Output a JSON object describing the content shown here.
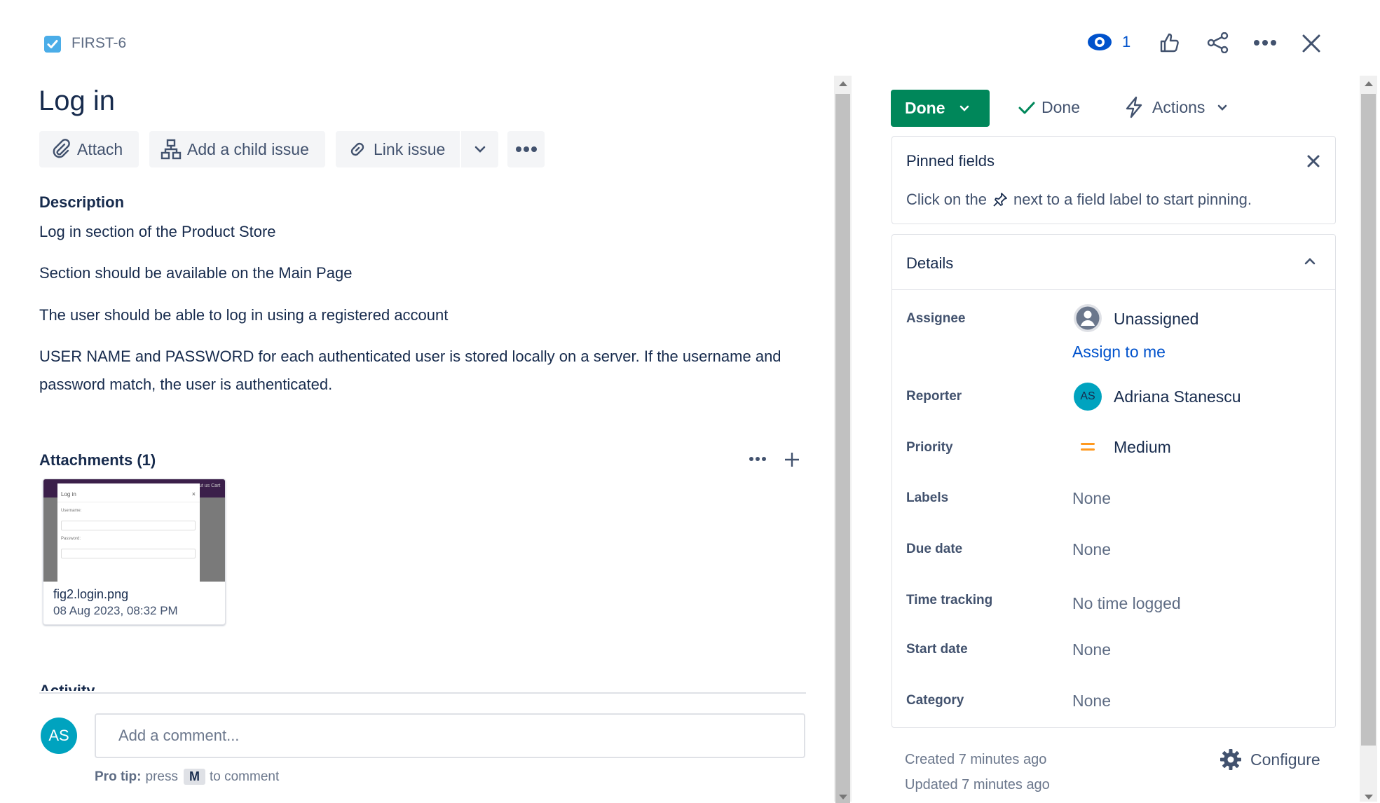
{
  "issue": {
    "key": "FIRST-6",
    "title": "Log in",
    "watch_count": "1"
  },
  "toolbar": {
    "attach": "Attach",
    "add_child": "Add a child issue",
    "link_issue": "Link issue"
  },
  "description": {
    "heading": "Description",
    "paragraphs": [
      "Log in section of the Product Store",
      "Section should be available on the Main Page",
      "The user should be able to log in using a registered account",
      "USER NAME and PASSWORD for each authenticated user is stored locally on a server. If the username and",
      "password  match, the user is authenticated."
    ]
  },
  "attachments": {
    "heading": "Attachments (1)",
    "items": [
      {
        "filename": "fig2.login.png",
        "date": "08 Aug 2023, 08:32 PM",
        "thumb": {
          "dialog_title": "Log in",
          "username_label": "Username:",
          "password_label": "Password:",
          "header_text": "ut us  Cart"
        }
      }
    ]
  },
  "activity": {
    "heading": "Activity",
    "avatar_initials": "AS",
    "comment_placeholder": "Add a comment...",
    "pro_tip_bold": "Pro tip:",
    "pro_tip_press": "press",
    "pro_tip_key": "M",
    "pro_tip_suffix": "to comment"
  },
  "status": {
    "button": "Done",
    "resolution": "Done",
    "actions": "Actions"
  },
  "pinned": {
    "heading": "Pinned fields",
    "text_before": "Click on the",
    "text_after": "next to a field label to start pinning."
  },
  "details": {
    "heading": "Details",
    "assignee_label": "Assignee",
    "assignee_value": "Unassigned",
    "assign_to_me": "Assign to me",
    "reporter_label": "Reporter",
    "reporter_initials": "AS",
    "reporter_value": "Adriana Stanescu",
    "priority_label": "Priority",
    "priority_value": "Medium",
    "labels_label": "Labels",
    "labels_value": "None",
    "due_label": "Due date",
    "due_value": "None",
    "time_label": "Time tracking",
    "time_value": "No time logged",
    "start_label": "Start date",
    "start_value": "None",
    "category_label": "Category",
    "category_value": "None"
  },
  "footer": {
    "created": "Created 7 minutes ago",
    "updated": "Updated 7 minutes ago",
    "configure": "Configure"
  },
  "colors": {
    "done_green": "#00875a",
    "link_blue": "#0052cc",
    "avatar_teal": "#00a3bf",
    "priority_orange": "#ff991f",
    "checkbox_blue": "#4bade8"
  }
}
